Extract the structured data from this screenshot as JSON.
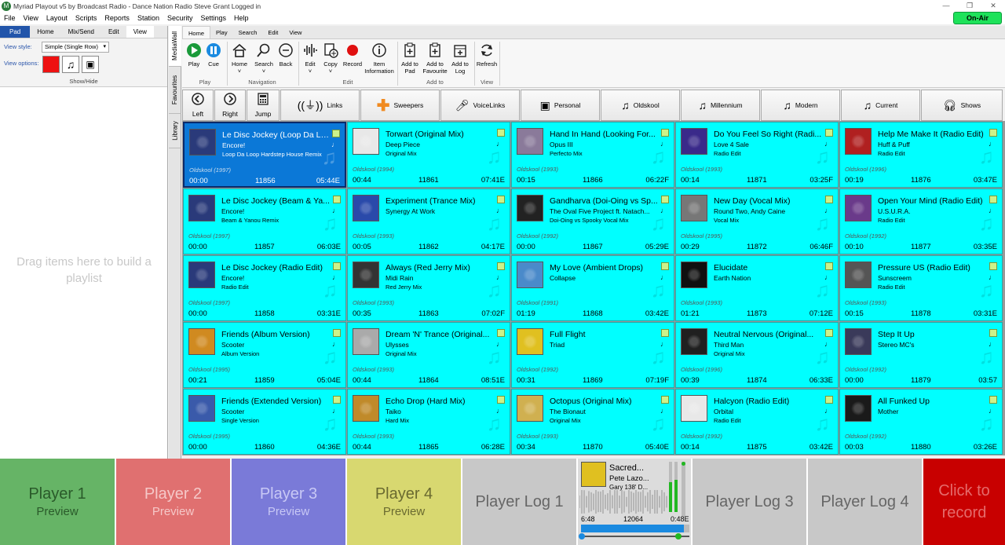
{
  "window": {
    "title": "Myriad Playout v5 by Broadcast Radio - Dance Nation Radio Steve Grant Logged in",
    "onair_label": "On-Air"
  },
  "menu": [
    "File",
    "View",
    "Layout",
    "Scripts",
    "Reports",
    "Station",
    "Security",
    "Settings",
    "Help"
  ],
  "left_panel": {
    "tabs": [
      "Pad",
      "Home",
      "Mix/Send",
      "Edit",
      "View"
    ],
    "view_style_label": "View style:",
    "view_style_value": "Simple (Single Row)",
    "view_options_label": "View options:",
    "show_hide_label": "Show/Hide",
    "drag_message": "Drag items here to build a playlist"
  },
  "side_tabs": [
    "MediaWall",
    "Favourites",
    "Library"
  ],
  "ribbon": {
    "tabs": [
      "Home",
      "Play",
      "Search",
      "Edit",
      "View"
    ],
    "buttons": {
      "play": "Play",
      "cue": "Cue",
      "home": "Home",
      "search": "Search",
      "back": "Back",
      "edit": "Edit",
      "copy": "Copy",
      "record": "Record",
      "item_info": "Item Information",
      "add_to_pad": "Add to Pad",
      "add_to_favourite": "Add to Favourite",
      "add_to_log": "Add to Log",
      "refresh": "Refresh"
    },
    "groups": {
      "play": "Play",
      "navigation": "Navigation",
      "edit": "Edit",
      "add_to": "Add to",
      "view": "View"
    }
  },
  "nav_buttons": {
    "left": "Left",
    "right": "Right",
    "jump": "Jump",
    "categories": [
      "Links",
      "Sweepers",
      "VoiceLinks",
      "Personal",
      "Oldskool",
      "Millennium",
      "Modern",
      "Current",
      "Shows"
    ]
  },
  "carts": [
    {
      "title": "Le Disc Jockey (Loop Da Lo...",
      "artist": "Encore!",
      "version": "Loop Da Loop Hardstep House Remix",
      "category": "Oldskool (1997)",
      "intro": "00:00",
      "number": "11856",
      "duration": "05:44E",
      "selected": true,
      "art_color": "#2a3a7a"
    },
    {
      "title": "Torwart (Original Mix)",
      "artist": "Deep Piece",
      "version": "Original Mix",
      "category": "Oldskool (1994)",
      "intro": "00:44",
      "number": "11861",
      "duration": "07:41E",
      "art_color": "#e8e8e8"
    },
    {
      "title": "Hand In Hand (Looking For...",
      "artist": "Opus III",
      "version": "Perfecto Mix",
      "category": "Oldskool (1993)",
      "intro": "00:15",
      "number": "11866",
      "duration": "06:22F",
      "art_color": "#8a7a9a"
    },
    {
      "title": "Do You Feel So Right (Radi...",
      "artist": "Love 4 Sale",
      "version": "Radio Edit",
      "category": "Oldskool (1993)",
      "intro": "00:14",
      "number": "11871",
      "duration": "03:25F",
      "art_color": "#3a2a8a"
    },
    {
      "title": "Help Me Make It (Radio Edit)",
      "artist": "Huff & Puff",
      "version": "Radio Edit",
      "category": "Oldskool (1996)",
      "intro": "00:19",
      "number": "11876",
      "duration": "03:47E",
      "art_color": "#b02020"
    },
    {
      "title": "Le Disc Jockey (Beam & Ya...",
      "artist": "Encore!",
      "version": "Beam & Yanou Remix",
      "category": "Oldskool (1997)",
      "intro": "00:00",
      "number": "11857",
      "duration": "06:03E",
      "art_color": "#2a3a7a"
    },
    {
      "title": "Experiment (Trance Mix)",
      "artist": "Synergy At Work",
      "version": "",
      "category": "Oldskool (1993)",
      "intro": "00:05",
      "number": "11862",
      "duration": "04:17E",
      "art_color": "#2a4aaa"
    },
    {
      "title": "Gandharva (Doi-Oing vs Sp...",
      "artist": "The Oval Five Project ft. Natach...",
      "version": "Doi-Oing vs Spooky Vocal Mix",
      "category": "Oldskool (1992)",
      "intro": "00:00",
      "number": "11867",
      "duration": "05:29E",
      "art_color": "#222222"
    },
    {
      "title": "New Day (Vocal Mix)",
      "artist": "Round Two, Andy Caine",
      "version": "Vocal Mix",
      "category": "Oldskool (1995)",
      "intro": "00:29",
      "number": "11872",
      "duration": "06:46F",
      "art_color": "#777777"
    },
    {
      "title": "Open Your Mind (Radio Edit)",
      "artist": "U.S.U.R.A.",
      "version": "Radio Edit",
      "category": "Oldskool (1992)",
      "intro": "00:10",
      "number": "11877",
      "duration": "03:35E",
      "art_color": "#6a3a8a"
    },
    {
      "title": "Le Disc Jockey (Radio Edit)",
      "artist": "Encore!",
      "version": "Radio Edit",
      "category": "Oldskool (1997)",
      "intro": "00:00",
      "number": "11858",
      "duration": "03:31E",
      "art_color": "#2a3a7a"
    },
    {
      "title": "Always (Red Jerry Mix)",
      "artist": "Midi Rain",
      "version": "Red Jerry Mix",
      "category": "Oldskool (1993)",
      "intro": "00:35",
      "number": "11863",
      "duration": "07:02F",
      "art_color": "#333333"
    },
    {
      "title": "My Love (Ambient Drops)",
      "artist": "Collapse",
      "version": "",
      "category": "Oldskool (1991)",
      "intro": "01:19",
      "number": "11868",
      "duration": "03:42E",
      "art_color": "#4a8aca"
    },
    {
      "title": "Elucidate",
      "artist": "Earth Nation",
      "version": "",
      "category": "Oldskool (1993)",
      "intro": "01:21",
      "number": "11873",
      "duration": "07:12E",
      "art_color": "#101010"
    },
    {
      "title": "Pressure US (Radio Edit)",
      "artist": "Sunscreem",
      "version": "Radio Edit",
      "category": "Oldskool (1993)",
      "intro": "00:15",
      "number": "11878",
      "duration": "03:31E",
      "art_color": "#555555"
    },
    {
      "title": "Friends (Album Version)",
      "artist": "Scooter",
      "version": "Album Version",
      "category": "Oldskool (1995)",
      "intro": "00:21",
      "number": "11859",
      "duration": "05:04E",
      "art_color": "#d08a20"
    },
    {
      "title": "Dream 'N' Trance (Original...",
      "artist": "Ulysses",
      "version": "Original Mix",
      "category": "Oldskool (1993)",
      "intro": "00:44",
      "number": "11864",
      "duration": "08:51E",
      "art_color": "#aaaaaa"
    },
    {
      "title": "Full Flight",
      "artist": "Triad",
      "version": "",
      "category": "Oldskool (1992)",
      "intro": "00:31",
      "number": "11869",
      "duration": "07:19F",
      "art_color": "#e0c020"
    },
    {
      "title": "Neutral Nervous (Original...",
      "artist": "Third Man",
      "version": "Original Mix",
      "category": "Oldskool (1996)",
      "intro": "00:39",
      "number": "11874",
      "duration": "06:33E",
      "art_color": "#202020"
    },
    {
      "title": "Step It Up",
      "artist": "Stereo MC's",
      "version": "",
      "category": "Oldskool (1992)",
      "intro": "00:00",
      "number": "11879",
      "duration": "03:57",
      "art_color": "#3a3a5a"
    },
    {
      "title": "Friends (Extended Version)",
      "artist": "Scooter",
      "version": "Single Version",
      "category": "Oldskool (1995)",
      "intro": "00:00",
      "number": "11860",
      "duration": "04:36E",
      "art_color": "#3a5aaa"
    },
    {
      "title": "Echo Drop (Hard Mix)",
      "artist": "Taiko",
      "version": "Hard Mix",
      "category": "Oldskool (1993)",
      "intro": "00:44",
      "number": "11865",
      "duration": "06:28E",
      "art_color": "#c08a2a"
    },
    {
      "title": "Octopus (Original Mix)",
      "artist": "The Bionaut",
      "version": "Original Mix",
      "category": "Oldskool (1993)",
      "intro": "00:34",
      "number": "11870",
      "duration": "05:40E",
      "art_color": "#d0b050"
    },
    {
      "title": "Halcyon (Radio Edit)",
      "artist": "Orbital",
      "version": "Radio Edit",
      "category": "Oldskool (1992)",
      "intro": "00:14",
      "number": "11875",
      "duration": "03:42E",
      "art_color": "#e8e8e8"
    },
    {
      "title": "All Funked Up",
      "artist": "Mother",
      "version": "",
      "category": "Oldskool (1992)",
      "intro": "00:03",
      "number": "11880",
      "duration": "03:26E",
      "art_color": "#1a1a1a"
    }
  ],
  "players": [
    {
      "title": "Player 1",
      "sub": "Preview",
      "bg": "#66b466",
      "fg": "#2a5a2a"
    },
    {
      "title": "Player 2",
      "sub": "Preview",
      "bg": "#e07070",
      "fg": "#f5c8c8"
    },
    {
      "title": "Player 3",
      "sub": "Preview",
      "bg": "#7a7ad8",
      "fg": "#c8c8f5"
    },
    {
      "title": "Player 4",
      "sub": "Preview",
      "bg": "#d8d870",
      "fg": "#6a6a30"
    }
  ],
  "player_logs": [
    "Player Log 1",
    "Player Log 3",
    "Player Log 4"
  ],
  "active_player": {
    "title": "Sacred...",
    "artist": "Pete Lazo...",
    "version": "Gary 138' D...",
    "elapsed": "6:48",
    "number": "12064",
    "remaining": "0:48E",
    "progress": 0.95
  },
  "record_button": "Click to record"
}
